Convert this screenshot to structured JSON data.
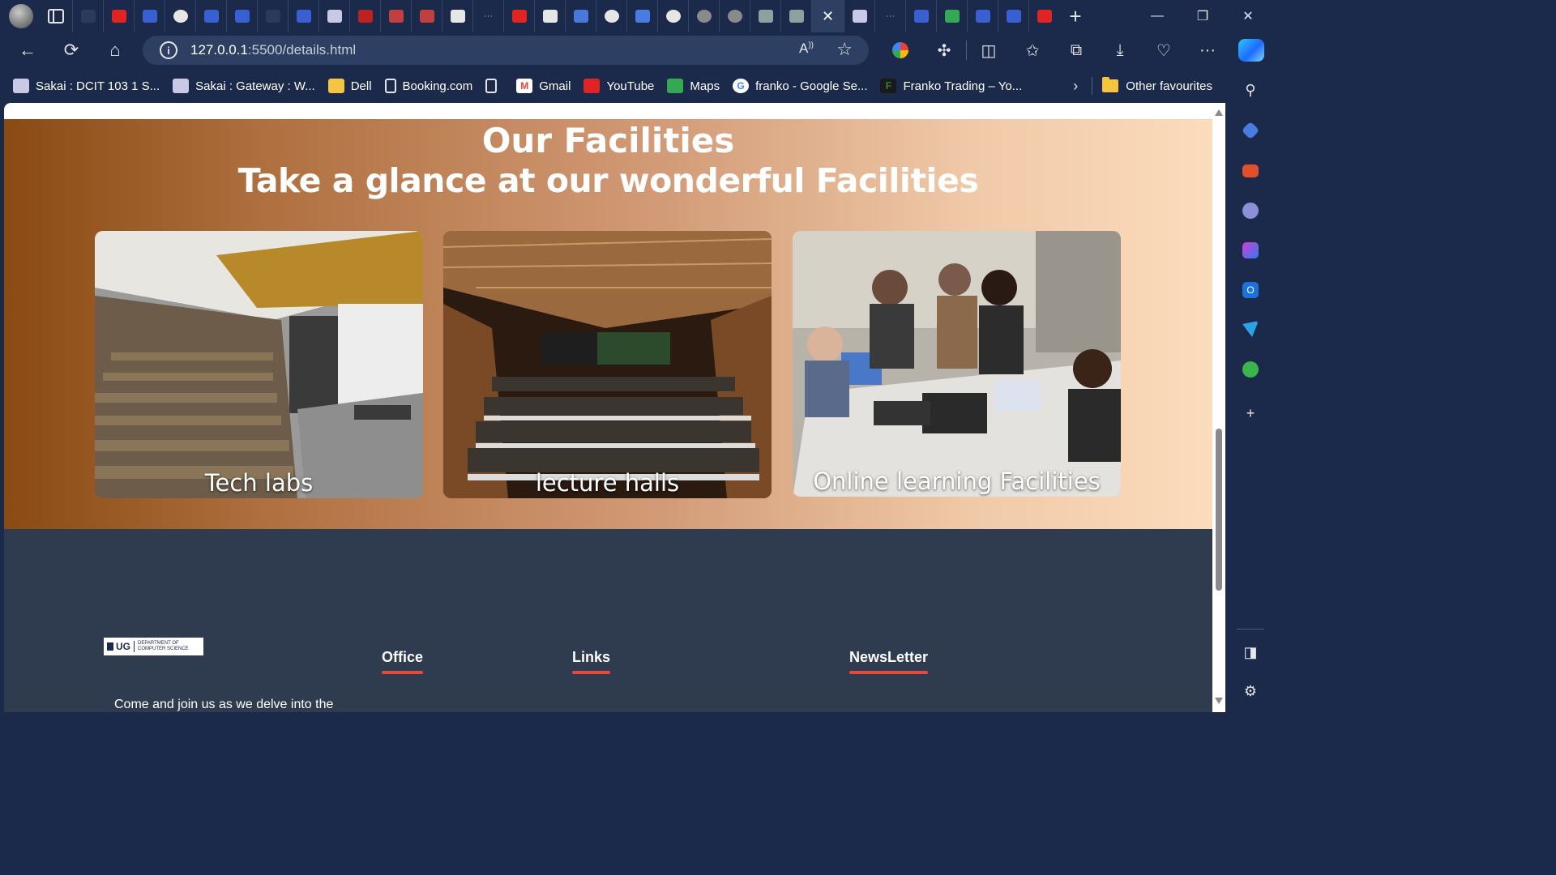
{
  "browser": {
    "tabs": [
      {
        "icon": "document-icon",
        "color": "#2a3a5c"
      },
      {
        "icon": "youtube-icon",
        "color": "#e02424"
      },
      {
        "icon": "search-icon",
        "color": "#3a5fd0"
      },
      {
        "icon": "github-icon",
        "color": "#e6e6e6"
      },
      {
        "icon": "search-icon",
        "color": "#3a5fd0"
      },
      {
        "icon": "search-icon",
        "color": "#3a5fd0"
      },
      {
        "icon": "document-icon",
        "color": "#2a3a5c"
      },
      {
        "icon": "search-icon",
        "color": "#3a5fd0"
      },
      {
        "icon": "sakai-icon",
        "color": "#c9c9e6"
      },
      {
        "icon": "youtube-icon",
        "color": "#b22"
      },
      {
        "icon": "pdf-icon",
        "color": "#c04040"
      },
      {
        "icon": "pdf-icon",
        "color": "#c04040"
      },
      {
        "icon": "chatgpt-icon",
        "color": "#e6e6e6"
      },
      {
        "icon": "ellipsis-icon",
        "color": "#9fb0d0"
      },
      {
        "icon": "youtube-icon",
        "color": "#e02424"
      },
      {
        "icon": "page-icon",
        "color": "#e6e6e6"
      },
      {
        "icon": "flag-icon",
        "color": "#4a78d8"
      },
      {
        "icon": "github-icon",
        "color": "#e6e6e6"
      },
      {
        "icon": "docs-icon",
        "color": "#4a7be0"
      },
      {
        "icon": "github-icon",
        "color": "#e6e6e6"
      },
      {
        "icon": "github-icon",
        "color": "#8a8a8a"
      },
      {
        "icon": "github-icon",
        "color": "#8a8a8a"
      },
      {
        "icon": "chatgpt-icon",
        "color": "#8fa0a0"
      },
      {
        "icon": "chatgpt-icon",
        "color": "#8fa0a0"
      }
    ],
    "tabs_after": [
      {
        "icon": "sakai-icon",
        "color": "#c9c9e6"
      },
      {
        "icon": "ellipsis-icon",
        "color": "#9fb0d0"
      },
      {
        "icon": "search-icon",
        "color": "#3a5fd0"
      },
      {
        "icon": "maps-icon",
        "color": "#34a853"
      },
      {
        "icon": "search-icon",
        "color": "#3a5fd0"
      },
      {
        "icon": "search-icon",
        "color": "#3a5fd0"
      },
      {
        "icon": "youtube-icon",
        "color": "#e02424"
      }
    ],
    "active_tab_icon": "close-icon",
    "address": {
      "host": "127.0.0.1",
      "path": ":5500/details.html"
    },
    "bookmarks": [
      {
        "label": "Sakai : DCIT 103 1 S...",
        "icon": "sakai-icon"
      },
      {
        "label": "Sakai : Gateway : W...",
        "icon": "sakai-icon"
      },
      {
        "label": "Dell",
        "icon": "folder-icon"
      },
      {
        "label": "Booking.com",
        "icon": "page-icon"
      },
      {
        "label": "",
        "icon": "page-icon"
      },
      {
        "label": "Gmail",
        "icon": "gmail-icon"
      },
      {
        "label": "YouTube",
        "icon": "youtube-icon"
      },
      {
        "label": "Maps",
        "icon": "maps-icon"
      },
      {
        "label": "franko - Google Se...",
        "icon": "google-icon"
      },
      {
        "label": "Franko Trading – Yo...",
        "icon": "franko-icon"
      }
    ],
    "other_favourites": "Other favourites"
  },
  "page": {
    "facilities": {
      "title": "Our Facilities",
      "subtitle": "Take a glance at our wonderful Facilities",
      "cards": [
        {
          "caption": "Tech labs"
        },
        {
          "caption": "lecture halls"
        },
        {
          "caption": "Online learning Facilities"
        }
      ]
    },
    "footer": {
      "logo_ug": "UG",
      "logo_dept": "DEPARTMENT OF COMPUTER SCIENCE",
      "headings": [
        "Office",
        "Links",
        "NewsLetter"
      ],
      "intro_text": "Come and join us as we delve into the"
    }
  },
  "colors": {
    "browser_chrome": "#1b2a4b",
    "footer_bg": "#2f3c4f",
    "heading_underline": "#e84a3a"
  }
}
